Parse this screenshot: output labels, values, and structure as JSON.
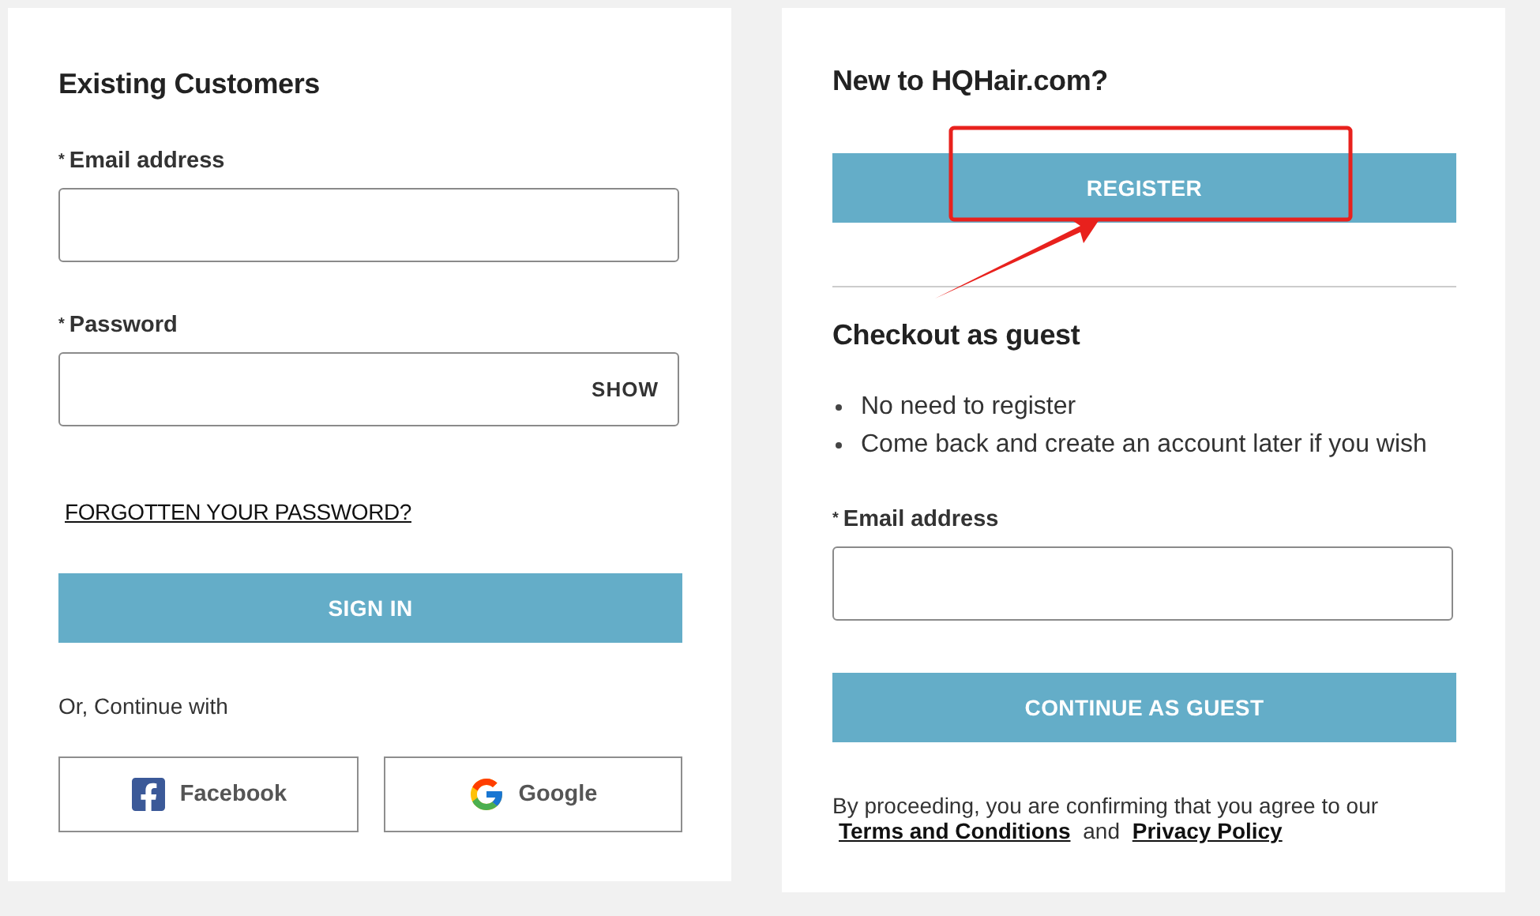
{
  "login": {
    "title": "Existing Customers",
    "fields": [
      {
        "mark": "*",
        "label": "Email address"
      },
      {
        "mark": "*",
        "label": "Password",
        "toggle": "SHOW"
      }
    ],
    "forgot_link": "FORGOTTEN YOUR PASSWORD?",
    "submit": "SIGN IN",
    "social_prompt": "Or, Continue with",
    "social": [
      {
        "kind": "facebook",
        "label": "Facebook"
      },
      {
        "kind": "google",
        "label": "Google"
      }
    ]
  },
  "register": {
    "title": "New to HQHair.com?",
    "button": "REGISTER"
  },
  "guest": {
    "title": "Checkout as guest",
    "benefits": [
      "No need to register",
      "Come back and create an account later if you wish"
    ],
    "field": {
      "mark": "*",
      "label": "Email address"
    },
    "button": "CONTINUE AS GUEST",
    "legal": {
      "text": "By proceeding, you are confirming that you agree to our",
      "links": [
        "Terms and Conditions",
        "Privacy Policy"
      ],
      "joiner": "and"
    }
  }
}
